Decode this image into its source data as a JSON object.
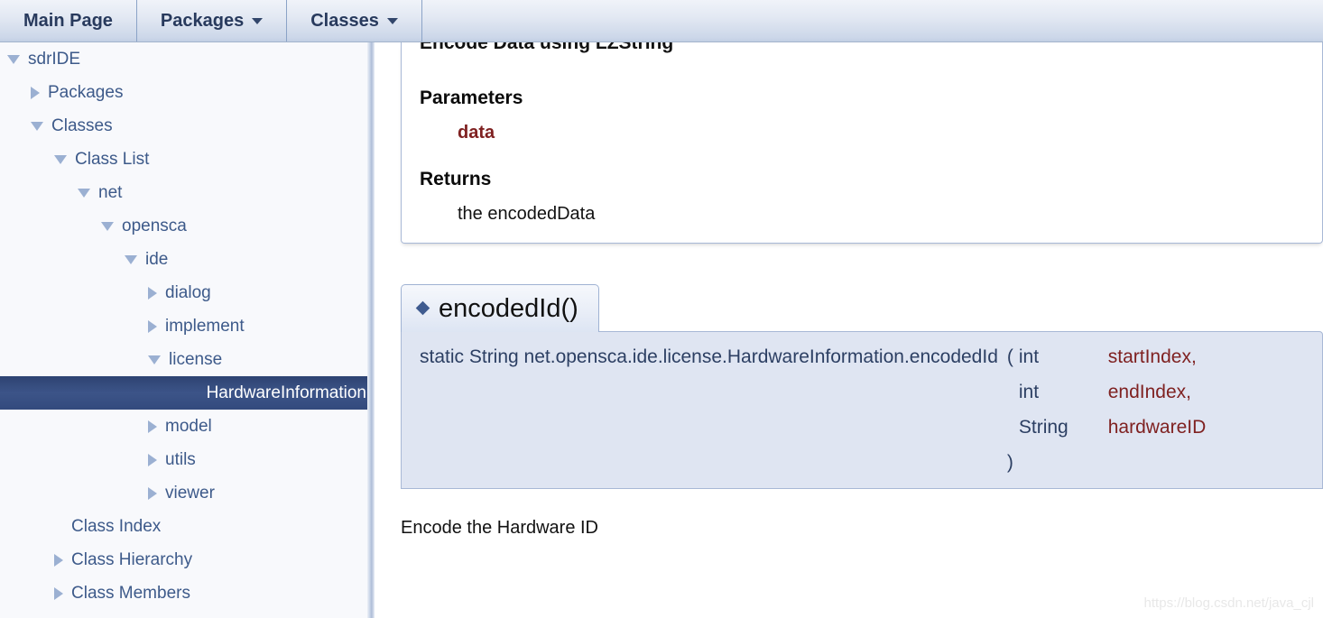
{
  "navbar": {
    "items": [
      {
        "label": "Main Page",
        "has_caret": false
      },
      {
        "label": "Packages",
        "has_caret": true
      },
      {
        "label": "Classes",
        "has_caret": true
      }
    ]
  },
  "sidebar": {
    "items": [
      {
        "label": "sdrIDE",
        "indent": 0,
        "state": "open",
        "selected": false
      },
      {
        "label": "Packages",
        "indent": 1,
        "state": "closed",
        "selected": false
      },
      {
        "label": "Classes",
        "indent": 1,
        "state": "open",
        "selected": false
      },
      {
        "label": "Class List",
        "indent": 2,
        "state": "open",
        "selected": false
      },
      {
        "label": "net",
        "indent": 3,
        "state": "open",
        "selected": false
      },
      {
        "label": "opensca",
        "indent": 4,
        "state": "open",
        "selected": false
      },
      {
        "label": "ide",
        "indent": 5,
        "state": "open",
        "selected": false
      },
      {
        "label": "dialog",
        "indent": 6,
        "state": "closed",
        "selected": false
      },
      {
        "label": "implement",
        "indent": 6,
        "state": "closed",
        "selected": false
      },
      {
        "label": "license",
        "indent": 6,
        "state": "open",
        "selected": false
      },
      {
        "label": "HardwareInformation",
        "indent": 7,
        "state": "none",
        "selected": true
      },
      {
        "label": "model",
        "indent": 6,
        "state": "closed",
        "selected": false
      },
      {
        "label": "utils",
        "indent": 6,
        "state": "closed",
        "selected": false
      },
      {
        "label": "viewer",
        "indent": 6,
        "state": "closed",
        "selected": false
      },
      {
        "label": "Class Index",
        "indent": 2,
        "state": "none",
        "selected": false
      },
      {
        "label": "Class Hierarchy",
        "indent": 2,
        "state": "closed",
        "selected": false
      },
      {
        "label": "Class Members",
        "indent": 2,
        "state": "closed",
        "selected": false
      }
    ]
  },
  "previous_member": {
    "cut_description": "Encode Data using LZString",
    "parameters_heading": "Parameters",
    "parameter_name": "data",
    "returns_heading": "Returns",
    "returns_text": "the encodedData"
  },
  "member": {
    "title": "encodedId()",
    "signature_prefix": "static String net.opensca.ide.license.HardwareInformation.encodedId",
    "open_paren": "(",
    "close_paren": ")",
    "params": [
      {
        "type": "int",
        "name": "startIndex,"
      },
      {
        "type": "int",
        "name": "endIndex,"
      },
      {
        "type": "String",
        "name": "hardwareID"
      }
    ],
    "description": "Encode the Hardware ID"
  },
  "watermark": "https://blog.csdn.net/java_cjl",
  "colors": {
    "accent": "#3d5a8a",
    "selected_bg": "#3c5488",
    "param_red": "#7f2121",
    "proto_bg": "#dfe5f2",
    "sidebar_bg": "#f8f9fc"
  }
}
